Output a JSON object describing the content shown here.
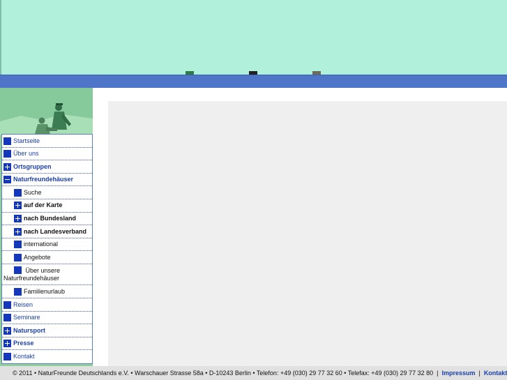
{
  "nav": {
    "items": [
      {
        "label": "Startseite",
        "icon": "square-icon"
      },
      {
        "label": "Über uns",
        "icon": "square-icon"
      },
      {
        "label": "Ortsgruppen",
        "icon": "plus-icon"
      },
      {
        "label": "Naturfreundehäuser",
        "icon": "minus-icon"
      },
      {
        "label": "Suche",
        "icon": "square-icon"
      },
      {
        "label": "auf der Karte",
        "icon": "plus-icon"
      },
      {
        "label": "nach Bundesland",
        "icon": "plus-icon"
      },
      {
        "label": "nach Landesverband",
        "icon": "plus-icon"
      },
      {
        "label": "international",
        "icon": "square-icon"
      },
      {
        "label": "Angebote",
        "icon": "square-icon"
      },
      {
        "label": "Über unsere Naturfreundehäuser",
        "icon": "square-icon"
      },
      {
        "label": "Familienurlaub",
        "icon": "square-icon"
      },
      {
        "label": "Reisen",
        "icon": "square-icon"
      },
      {
        "label": "Seminare",
        "icon": "square-icon"
      },
      {
        "label": "Natursport",
        "icon": "plus-icon"
      },
      {
        "label": "Presse",
        "icon": "plus-icon"
      },
      {
        "label": "Kontakt",
        "icon": "square-icon"
      }
    ]
  },
  "footer": {
    "text": "© 2011 • NaturFreunde Deutschlands e.V. • Warschauer Strasse 58a • D-10243 Berlin • Telefon: +49 (030) 29 77 32 60 • Telefax: +49 (030) 29 77 32 80",
    "impressum": "Impressum",
    "kontakt": "Kontakt",
    "separator": "|"
  },
  "colors": {
    "header": "#b1f1db",
    "bar": "#4e75c8",
    "nav_icon": "#1537b9",
    "link": "#1a3fa8",
    "content_panel": "#efefef",
    "footer_bg": "#e1e1e1"
  }
}
